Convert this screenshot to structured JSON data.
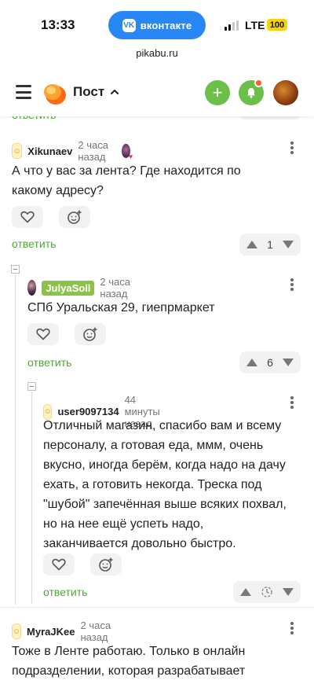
{
  "status_bar": {
    "time": "13:33",
    "vk_label": "вконтакте",
    "vk_logo": "VK",
    "network": "LTE",
    "battery": "100"
  },
  "browser": {
    "url": "pikabu.ru"
  },
  "header": {
    "title": "Пост",
    "chevron": "⌃",
    "add_icon": "+"
  },
  "prev_comment": {
    "reply_label": "ответить"
  },
  "comments": [
    {
      "author": "Xikunaev",
      "time": "2 часа назад",
      "text": "А что у вас за лента? Где находится по какому адресу?",
      "reply_label": "ответить",
      "rating": "1"
    },
    {
      "author": "JulyaSoll",
      "time": "2 часа назад",
      "text": "СПб Уральская 29, гиепрмаркет",
      "reply_label": "ответить",
      "rating": "6"
    },
    {
      "author": "user9097134",
      "time": "44 минуты назад",
      "text": "Отличный магазин, спасибо вам и всему персоналу, а готовая еда, ммм, очень вкусно, иногда берём, когда надо на дачу ехать, а готовить некогда. Треска под \"шубой\" запечённая выше всяких похвал, но на нее ещё успеть надо, заканчивается довольно быстро.",
      "reply_label": "ответить"
    },
    {
      "author": "MyraJKee",
      "time": "2 часа назад",
      "text": "Тоже в Ленте работаю. Только в онлайн подразделении, которая разрабатывает"
    }
  ],
  "colors": {
    "accent_green": "#6cc04a",
    "link_green": "#4ea832",
    "vk_blue": "#2787f5",
    "badge_green": "#8bc34a"
  },
  "icons": [
    "hamburger-icon",
    "pikabu-logo-icon",
    "chevron-up-icon",
    "plus-icon",
    "bell-icon",
    "heart-icon",
    "emoji-add-icon",
    "arrow-up-icon",
    "arrow-down-icon",
    "more-vertical-icon",
    "clock-icon"
  ]
}
